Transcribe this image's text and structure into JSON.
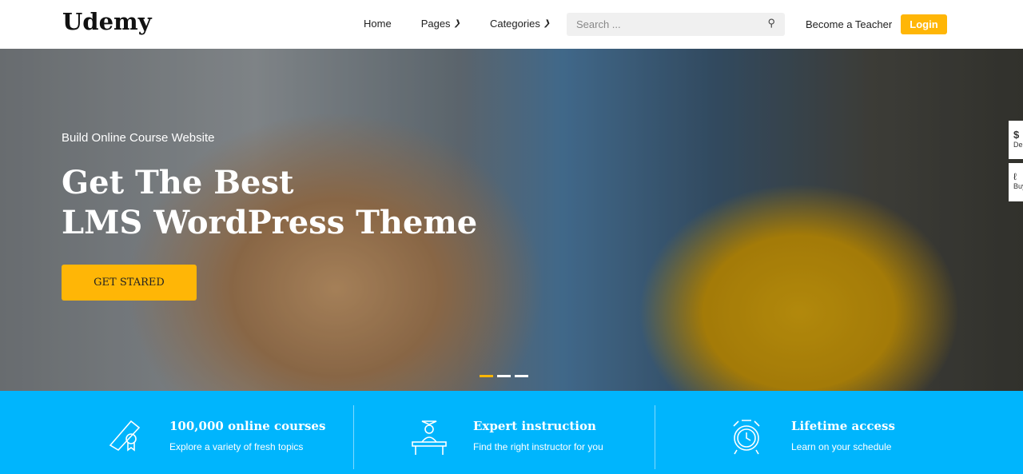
{
  "header": {
    "logo": "Udemy",
    "nav": [
      {
        "label": "Home"
      },
      {
        "label": "Pages"
      },
      {
        "label": "Categories"
      }
    ],
    "search_placeholder": "Search ...",
    "become_teacher": "Become a Teacher",
    "login": "Login"
  },
  "hero": {
    "subtitle": "Build Online Course Website",
    "title_line1": "Get The Best",
    "title_line2": "LMS WordPress Theme",
    "cta": "GET STARED",
    "slides": 3,
    "active_slide": 1
  },
  "side_tabs": [
    {
      "label": "De",
      "icon": "dollar-icon"
    },
    {
      "label": "Buy",
      "icon": "cart-icon"
    }
  ],
  "features": [
    {
      "title": "100,000 online courses",
      "desc": "Explore a variety of fresh topics",
      "icon": "diploma-icon"
    },
    {
      "title": "Expert instruction",
      "desc": "Find the right instructor for you",
      "icon": "instructor-icon"
    },
    {
      "title": "Lifetime access",
      "desc": "Learn on your schedule",
      "icon": "alarm-clock-icon"
    }
  ],
  "colors": {
    "accent": "#ffb606",
    "feature_bar": "#00b5fd"
  }
}
